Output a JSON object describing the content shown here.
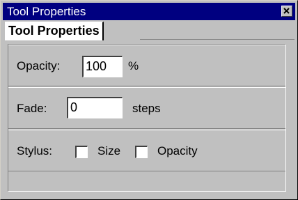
{
  "window": {
    "title": "Tool Properties",
    "close_icon": "close-icon"
  },
  "tabs": [
    {
      "label": "Tool Properties",
      "active": true
    }
  ],
  "opacity": {
    "label": "Opacity:",
    "value": "100",
    "unit": "%"
  },
  "fade": {
    "label": "Fade:",
    "value": "0",
    "unit": "steps"
  },
  "stylus": {
    "label": "Stylus:",
    "size_label": "Size",
    "size_checked": false,
    "opacity_label": "Opacity",
    "opacity_checked": false
  }
}
